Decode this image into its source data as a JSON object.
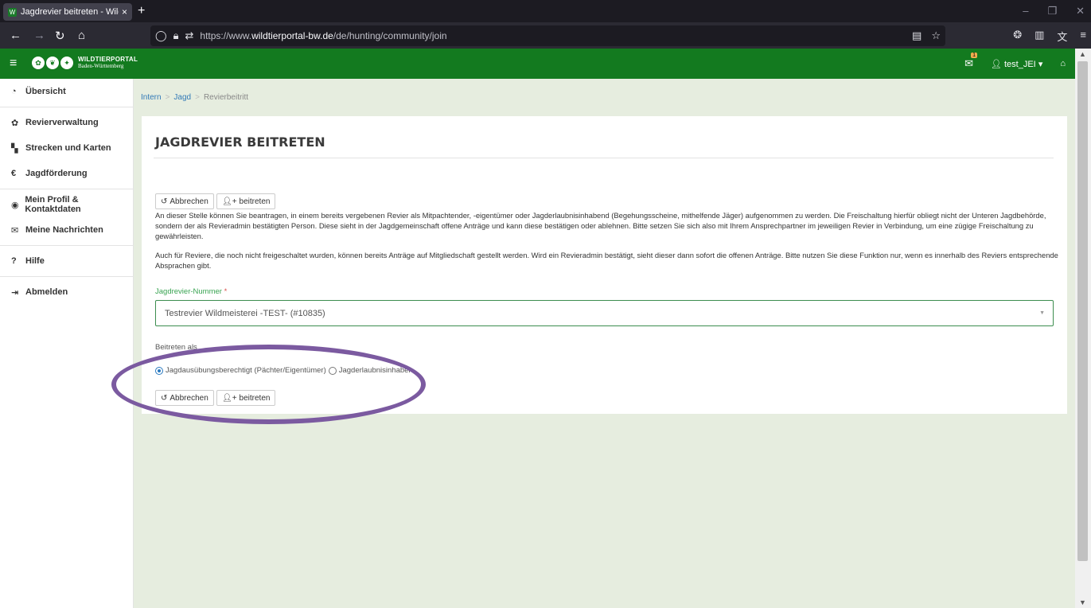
{
  "browser": {
    "tab_title": "Jagdrevier beitreten - Wildtierp",
    "new_tab": "+",
    "url_prefix": "https://www.",
    "url_host": "wildtierportal-bw.de",
    "url_path": "/de/hunting/community/join"
  },
  "header": {
    "logo_line1": "WILDTIERPORTAL",
    "logo_line2": "Baden-Württemberg",
    "mail_badge": "1",
    "user": "test_JEI"
  },
  "sidebar": {
    "items": [
      {
        "label": "Übersicht",
        "icon": "dashboard-icon"
      },
      {
        "label": "Revierverwaltung",
        "icon": "gear-icon"
      },
      {
        "label": "Strecken und Karten",
        "icon": "map-icon"
      },
      {
        "label": "Jagdförderung",
        "icon": "euro-icon"
      },
      {
        "label": "Mein Profil & Kontaktdaten",
        "icon": "user-circle-icon"
      },
      {
        "label": "Meine Nachrichten",
        "icon": "envelope-icon"
      },
      {
        "label": "Hilfe",
        "icon": "question-icon"
      },
      {
        "label": "Abmelden",
        "icon": "logout-icon"
      }
    ]
  },
  "breadcrumb": {
    "items": [
      "Intern",
      "Jagd",
      "Revierbeitritt"
    ]
  },
  "page": {
    "title": "JAGDREVIER BEITRETEN",
    "cancel_label": "Abbrechen",
    "join_label": "beitreten",
    "para1": "An dieser Stelle können Sie beantragen, in einem bereits vergebenen Revier als Mitpachtender, -eigentümer oder Jagderlaubnisinhabend (Begehungsscheine, mithelfende Jäger) aufgenommen zu werden. Die Freischaltung hierfür obliegt nicht der Unteren Jagdbehörde, sondern der als Revieradmin bestätigten Person. Diese sieht in der Jagdgemeinschaft offene Anträge und kann diese bestätigen oder ablehnen. Bitte setzen Sie sich also mit Ihrem Ansprechpartner im jeweiligen Revier in Verbindung, um eine zügige Freischaltung zu gewährleisten.",
    "para2": "Auch für Reviere, die noch nicht freigeschaltet wurden, können bereits Anträge auf Mitgliedschaft gestellt werden. Wird ein Revieradmin bestätigt, sieht dieser dann sofort die offenen Anträge. Bitte nutzen Sie diese Funktion nur, wenn es innerhalb des Reviers entsprechende Absprachen gibt.",
    "field_label": "Jagdrevier-Nummer",
    "field_required": "*",
    "field_value": "Testrevier Wildmeisterei -TEST- (#10835)",
    "join_as_label": "Beitreten als",
    "radio1": "Jagdausübungsberechtigt (Pächter/Eigentümer)",
    "radio2": "Jagderlaubnisinhaber",
    "radio_selected": "radio1"
  },
  "annotation_color": "#7b5aa0"
}
